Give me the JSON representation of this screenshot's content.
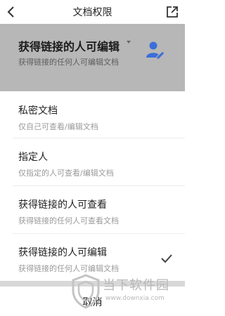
{
  "header": {
    "title": "文档权限",
    "back_icon": "chevron-left-icon",
    "share_icon": "share-external-icon"
  },
  "current": {
    "title": "获得链接的人可编辑",
    "desc": "获得链接的任何人可编辑文档",
    "icon": "person-edit-icon",
    "accent": "#3b6fd8"
  },
  "options": [
    {
      "label": "私密文档",
      "sub": "仅自己可查看/编辑文档",
      "selected": false
    },
    {
      "label": "指定人",
      "sub": "仅指定的人可查看/编辑文档",
      "selected": false
    },
    {
      "label": "获得链接的人可查看",
      "sub": "获得链接的任何人可查看文档",
      "selected": false
    },
    {
      "label": "获得链接的人可编辑",
      "sub": "获得链接的任何人可编辑文档",
      "selected": true
    }
  ],
  "cancel_label": "取消",
  "watermark": {
    "text": "当下软件园",
    "url": "www.downxia.com"
  }
}
